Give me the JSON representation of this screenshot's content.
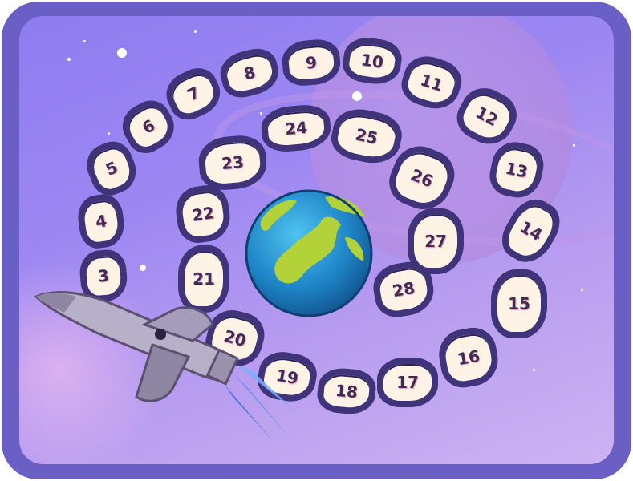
{
  "board": {
    "spaces": [
      {
        "n": "3"
      },
      {
        "n": "4"
      },
      {
        "n": "5"
      },
      {
        "n": "6"
      },
      {
        "n": "7"
      },
      {
        "n": "8"
      },
      {
        "n": "9"
      },
      {
        "n": "10"
      },
      {
        "n": "11"
      },
      {
        "n": "12"
      },
      {
        "n": "13"
      },
      {
        "n": "14"
      },
      {
        "n": "15"
      },
      {
        "n": "16"
      },
      {
        "n": "17"
      },
      {
        "n": "18"
      },
      {
        "n": "19"
      },
      {
        "n": "20"
      },
      {
        "n": "21"
      },
      {
        "n": "22"
      },
      {
        "n": "23"
      },
      {
        "n": "24"
      },
      {
        "n": "25"
      },
      {
        "n": "26"
      },
      {
        "n": "27"
      },
      {
        "n": "28"
      }
    ]
  },
  "colors": {
    "frame": "#6a5fc4",
    "space_fill": "#fff3e6",
    "space_border": "#3f347a",
    "number_text": "#3f2c5a"
  },
  "icons": {
    "center": "earth-icon",
    "player_token": "rocket-icon"
  }
}
